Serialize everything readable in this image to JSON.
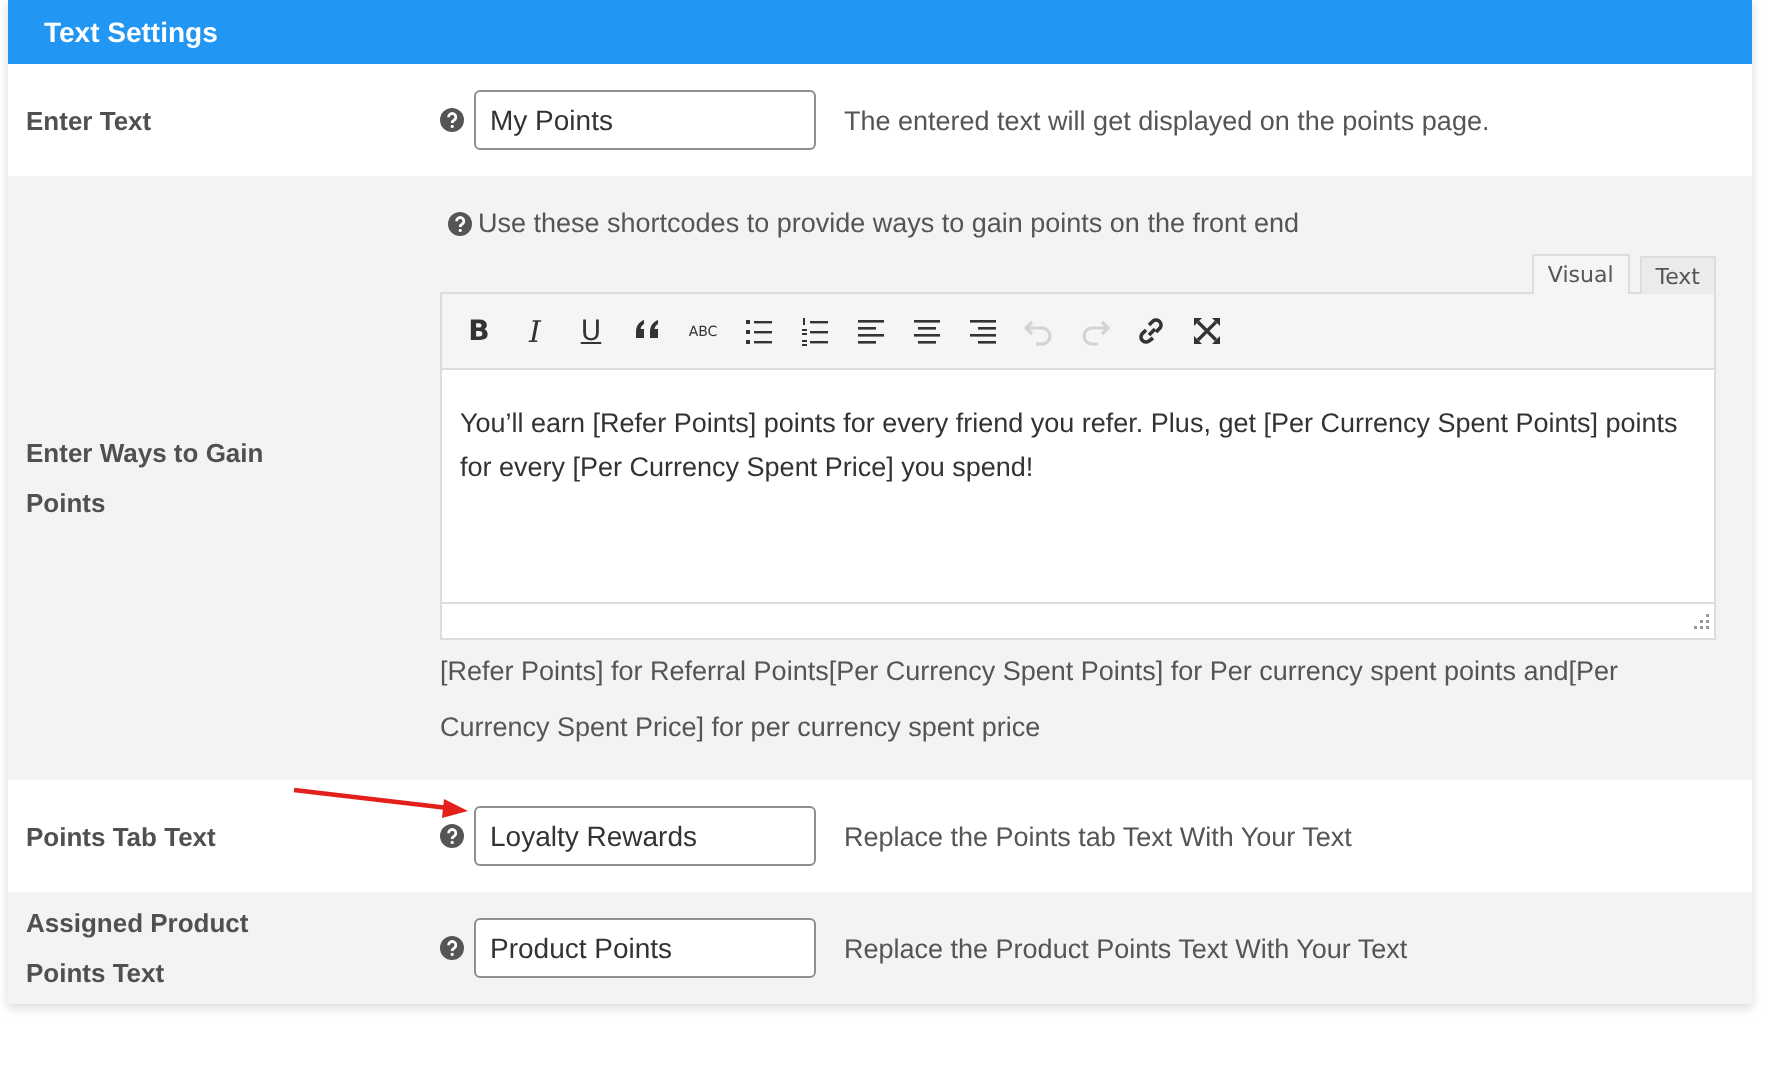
{
  "panel": {
    "title": "Text Settings"
  },
  "annotation": {
    "kind": "arrow"
  },
  "rows": [
    {
      "kind": "input",
      "label": "Enter Text",
      "help": true,
      "value": "My Points",
      "description": "The entered text will get displayed on the points page."
    },
    {
      "kind": "editor",
      "label": "Enter Ways to Gain Points",
      "help": true,
      "hint": "Use these shortcodes to provide ways to gain points on the front end",
      "tabs": [
        {
          "label": "Visual",
          "selected": true
        },
        {
          "label": "Text",
          "selected": false
        }
      ],
      "toolbar": [
        {
          "kind": "bold",
          "label": "B",
          "disabled": false
        },
        {
          "kind": "italic",
          "label": "I",
          "disabled": false
        },
        {
          "kind": "underline",
          "label": "U",
          "disabled": false
        },
        {
          "kind": "quote",
          "disabled": false
        },
        {
          "kind": "strike",
          "label": "ABC",
          "disabled": false
        },
        {
          "kind": "bullets",
          "disabled": false
        },
        {
          "kind": "numbers",
          "disabled": false
        },
        {
          "kind": "align-left",
          "disabled": false
        },
        {
          "kind": "align-center",
          "disabled": false
        },
        {
          "kind": "align-right",
          "disabled": false
        },
        {
          "kind": "undo",
          "disabled": true
        },
        {
          "kind": "redo",
          "disabled": true
        },
        {
          "kind": "link",
          "disabled": false
        },
        {
          "kind": "fullscreen",
          "disabled": false
        }
      ],
      "content": "You’ll earn [Refer Points] points for every friend you refer. Plus, get [Per Currency Spent Points] points for every [Per Currency Spent Price] you spend!",
      "description": "[Refer Points] for Referral Points[Per Currency Spent Points] for Per currency spent points and[Per Currency Spent Price] for per currency spent price"
    },
    {
      "kind": "input",
      "label": "Points Tab Text",
      "help": true,
      "value": "Loyalty Rewards",
      "description": "Replace the Points tab Text With Your Text"
    },
    {
      "kind": "input",
      "label": "Assigned Product Points Text",
      "help": true,
      "value": "Product Points",
      "description": "Replace the Product Points Text With Your Text"
    }
  ]
}
